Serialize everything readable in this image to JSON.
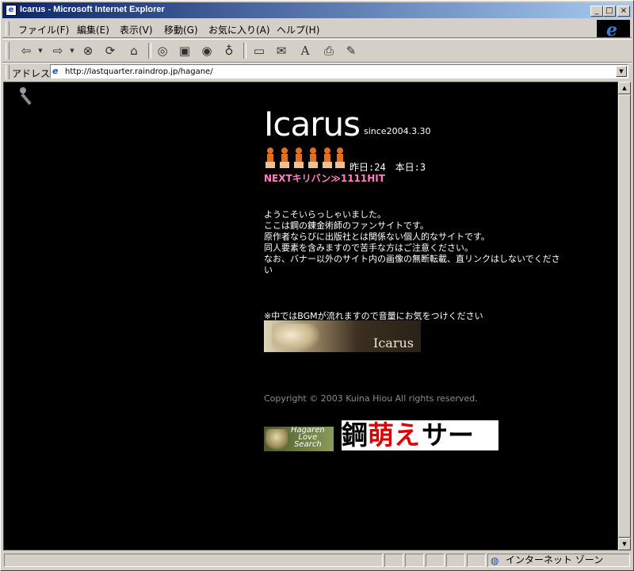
{
  "window": {
    "title": "Icarus - Microsoft Internet Explorer",
    "title_icon": "e",
    "controls": {
      "minimize": "_",
      "maximize": "□",
      "close": "×"
    }
  },
  "menu": [
    {
      "label": "ファイル(F)"
    },
    {
      "label": "編集(E)"
    },
    {
      "label": "表示(V)"
    },
    {
      "label": "移動(G)"
    },
    {
      "label": "お気に入り(A)"
    },
    {
      "label": "ヘルプ(H)"
    }
  ],
  "toolbar": {
    "icons": [
      "back-icon",
      "forward-icon",
      "stop-icon",
      "refresh-icon",
      "home-icon",
      "search-icon",
      "favorites-icon",
      "history-icon",
      "channels-icon",
      "fullscreen-icon",
      "mail-icon",
      "font-icon",
      "print-icon",
      "edit-icon"
    ]
  },
  "address": {
    "label": "アドレス",
    "url": "http://lastquarter.raindrop.jp/hagane/"
  },
  "page": {
    "title": "Icarus",
    "since": "since2004.3.30",
    "counter": "昨日:24　本日:3",
    "next_kiriban": "NEXTキリバン≫1111HIT",
    "welcome": [
      "ようこそいらっしゃいました。",
      "ここは鋼の錬金術師のファンサイトです。",
      "原作者ならびに出版社とは関係ない個人的なサイトです。",
      "同人要素を含みますので苦手な方はご注意ください。",
      "なお、バナー以外のサイト内の画像の無断転載、直リンクはしないでくださ",
      "い"
    ],
    "bgm_note": "※中ではBGMが流れますので音量にお気をつけください",
    "enter_banner_text": "Icarus",
    "copyright": "Copyright © 2003 Kuina Hiou All rights reserved.",
    "link_banners": {
      "hagaren_love_search": [
        "Hagaren",
        "Love",
        "Search"
      ],
      "moe_search": {
        "part1": "鋼",
        "part2": "萌え",
        "part3": "サーチ"
      }
    }
  },
  "status": {
    "zone": "インターネット ゾーン"
  }
}
